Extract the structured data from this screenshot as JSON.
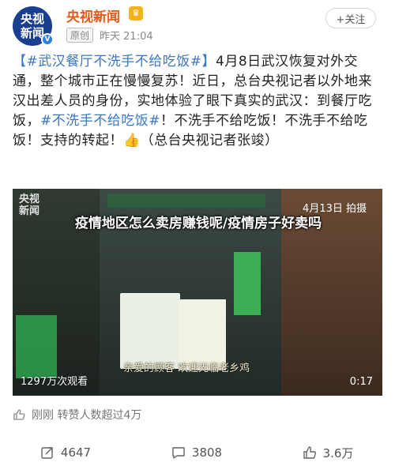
{
  "header": {
    "avatar_line1": "央视",
    "avatar_line2": "新闻",
    "name": "央视新闻",
    "tag": "原创",
    "time": "昨天 21:04",
    "follow_label": "+关注"
  },
  "post": {
    "topic1": "【#武汉餐厅不洗手不给吃饭#】",
    "text1": "4月8日武汉恢复对外交通，整个城市正在慢慢复苏！近日，总台央视记者以外地来汉出差人员的身份，实地体验了眼下真实的武汉：到餐厅吃饭，",
    "topic2": "#不洗手不给吃饭#",
    "text2": "！不洗手不给吃饭！不洗手不给吃饭！支持的转起！",
    "emoji": "👍",
    "text3": "（总台央视记者张竣）"
  },
  "video": {
    "watermark_line1": "央视",
    "watermark_line2": "新闻",
    "date_stamp": "4月13日 拍摄",
    "overlay_title": "疫情地区怎么卖房赚钱呢/疫情房子好卖吗",
    "caption": "亲爱的顾客 欢迎光临老乡鸡",
    "views": "1297万次观看",
    "duration": "0:17"
  },
  "likes_summary": "刚刚 转赞人数超过4万",
  "actions": {
    "repost_count": "4647",
    "comment_count": "3808",
    "like_count": "3.6万"
  },
  "colors": {
    "name": "#e25a1c",
    "topic": "#3a78c4",
    "avatar_bg": "#1a3f8f"
  }
}
